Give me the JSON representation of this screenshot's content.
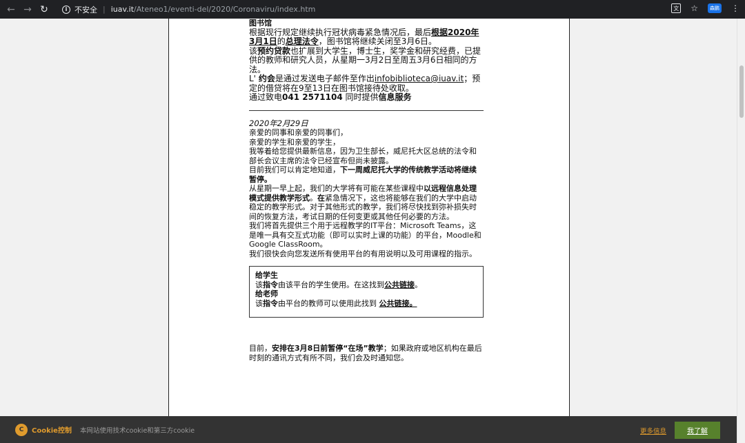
{
  "browser": {
    "insecure_label": "不安全",
    "url_host": "iuav.it",
    "url_path": "/Ateneo1/eventi-del/2020/Coronaviru/index.htm",
    "profile_label": "森鹏"
  },
  "article": {
    "library_heading": "图书馆",
    "lib_p1_a": "根据现行规定继续执行冠状病毒紧急情况后，最后",
    "lib_p1_link": "根据2020年3月1日",
    "lib_p1_b": "的",
    "lib_p1_link2": "总理法令",
    "lib_p1_c": "，图书馆将继续关闭至3月6日。",
    "lib_p2_a": "该",
    "lib_p2_bold": "预约贷款",
    "lib_p2_b": "也扩展到大学生，博士生，奖学金和研究经费，已提供的教师和研究人员，从星期一3月2日至周五3月6日相同的方法。",
    "lib_p3_a": "L' ",
    "lib_p3_bold": "约会",
    "lib_p3_b": "是通过发送电子邮件至作出",
    "lib_p3_email": "infobiblioteca@iuav.it",
    "lib_p3_c": "；预定的借贷将在9至13日在图书馆接待处收取。",
    "lib_p4_a": "通过致电",
    "lib_p4_phone": "041 2571104",
    "lib_p4_b": " 同时提供",
    "lib_p4_bold": "信息服务",
    "date": "2020年2月29日",
    "greeting1": "亲爱的同事和亲爱的同事们，",
    "greeting2": "亲爱的学生和亲爱的学生，",
    "para1_a": "我等着给您提供最新信息，因为卫生部长，威尼托大区总统的法令和部长会议主席的法令已经宣布但尚未披露。",
    "para1_b": "目前我们可以肯定地知道，",
    "para1_bold": "下一周威尼托大学的传统教学活动将继续暂停。",
    "para2_a": "从星期一早上起，我们的大学将有可能在某些课程中",
    "para2_bold": "以远程信息处理模式提供教学形式",
    "para2_b": "。",
    "para2_bold2": "在",
    "para2_c": "紧急情况下，这也将能够在我们的大学中启动稳定的教学形式。对于其他形式的教学，我们将尽快找到弥补损失时间的恢复方法，考试日期的任何变更或其他任何必要的方法。",
    "para3": "我们将首先提供三个用于远程教学的IT平台：Microsoft Teams，这是唯一具有交互式功能（即可以实时上课的功能）的平台，Moodle和Google ClassRoom。",
    "para4": "我们很快会向您发送所有使用平台的有用说明以及可用课程的指示。",
    "box": {
      "students_heading": "给学生",
      "students_a": "该",
      "students_bold": "指令",
      "students_b": "由该平台的学生使用。在这找到",
      "students_link": "公共链接",
      "students_c": "。",
      "teachers_heading": "给老师",
      "teachers_a": "该",
      "teachers_bold": "指令",
      "teachers_b": "由平台的教师可以使用此找到 ",
      "teachers_link": "公共链接。"
    },
    "final_a": "目前，",
    "final_bold": "安排在3月8日前暂停“在场”教学",
    "final_b": "；如果政府或地区机构在最后时刻的通讯方式有所不同，我们会及时通知您。"
  },
  "cookie": {
    "icon_glyph": "C",
    "title": "Cookie控制",
    "text": "本网站使用技术cookie和第三方cookie",
    "more_info": "更多信息",
    "accept": "我了解"
  }
}
